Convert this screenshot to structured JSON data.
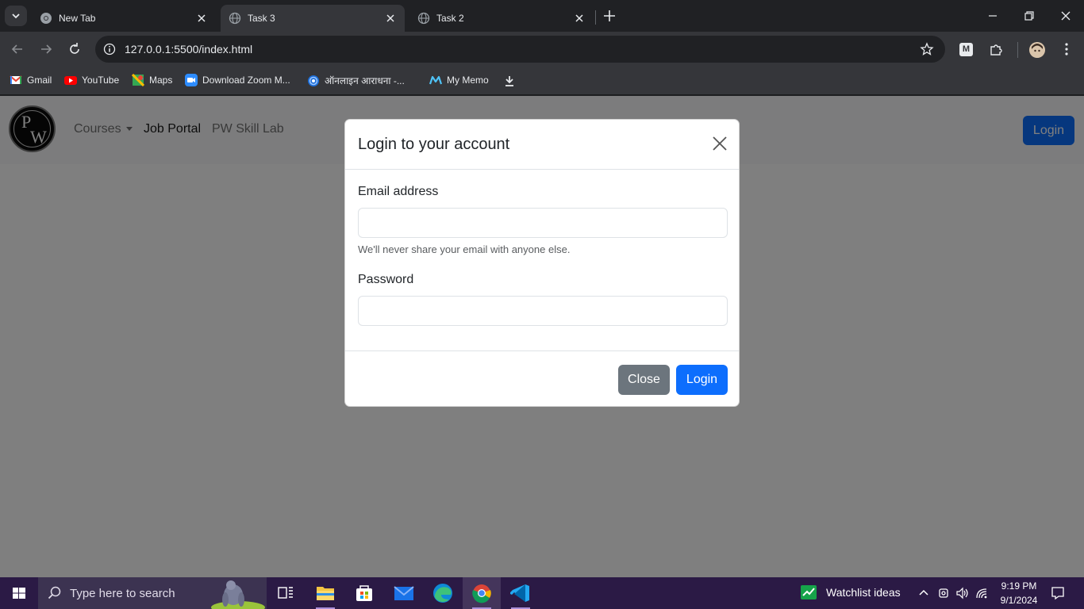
{
  "browser": {
    "tabs": [
      {
        "title": "New Tab",
        "active": false
      },
      {
        "title": "Task 3",
        "active": true
      },
      {
        "title": "Task 2",
        "active": false
      }
    ],
    "url": "127.0.0.1:5500/index.html",
    "bookmarks": [
      {
        "label": "Gmail",
        "icon": "gmail-icon"
      },
      {
        "label": "YouTube",
        "icon": "youtube-icon"
      },
      {
        "label": "Maps",
        "icon": "maps-icon"
      },
      {
        "label": "Download Zoom M...",
        "icon": "zoom-icon"
      },
      {
        "label": "ऑनलाइन आराधना -...",
        "icon": "globe-icon"
      },
      {
        "label": "My Memo",
        "icon": "mymemo-icon"
      }
    ]
  },
  "page": {
    "nav": {
      "logo_letters": [
        "P",
        "W"
      ],
      "links": [
        {
          "label": "Courses",
          "dropdown": true,
          "active": false
        },
        {
          "label": "Job Portal",
          "dropdown": false,
          "active": true
        },
        {
          "label": "PW Skill Lab",
          "dropdown": false,
          "active": false
        }
      ],
      "login_label": "Login"
    },
    "modal": {
      "title": "Login to your account",
      "email_label": "Email address",
      "email_value": "",
      "email_help": "We'll never share your email with anyone else.",
      "password_label": "Password",
      "password_value": "",
      "close_label": "Close",
      "login_label": "Login"
    }
  },
  "taskbar": {
    "search_placeholder": "Type here to search",
    "weather_text": "Watchlist ideas",
    "time": "9:19 PM",
    "date": "9/1/2024"
  },
  "colors": {
    "primary": "#0d6efd",
    "secondary": "#6c757d",
    "chrome_dark": "#202124",
    "chrome_toolbar": "#35363a",
    "taskbar": "#2b1a45"
  }
}
